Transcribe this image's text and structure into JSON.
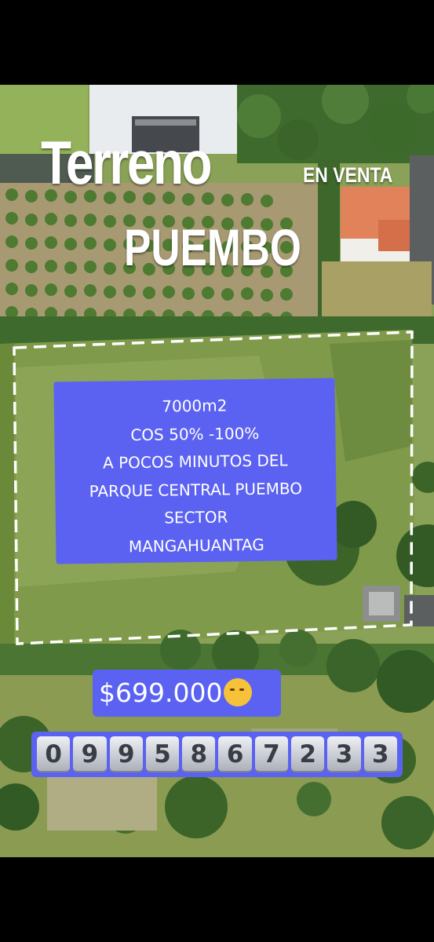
{
  "title": {
    "main": "Terreno",
    "tag": "EN VENTA",
    "city": "PUEMBO"
  },
  "info": {
    "lines": [
      "7000m2",
      "COS 50% -100%",
      "A POCOS MINUTOS DEL",
      "PARQUE CENTRAL PUEMBO",
      "SECTOR",
      "MANGAHUANTAG"
    ]
  },
  "price": {
    "label": "$699.000",
    "emoji": "partying-face-emoji"
  },
  "phone": {
    "digits": [
      "0",
      "9",
      "9",
      "5",
      "8",
      "6",
      "7",
      "2",
      "3",
      "3"
    ]
  },
  "colors": {
    "accent": "#5b62f2",
    "background": "#000000"
  }
}
